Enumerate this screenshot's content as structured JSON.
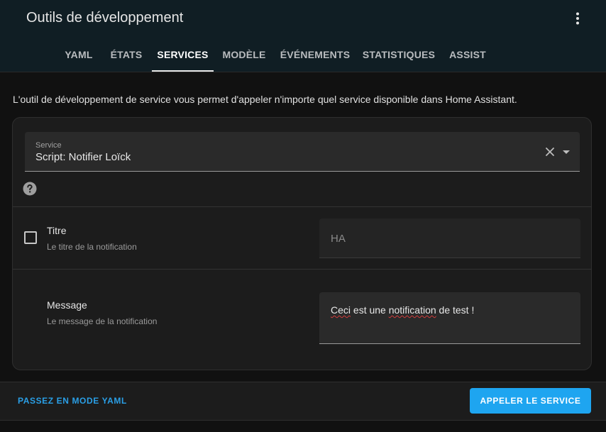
{
  "header": {
    "title": "Outils de développement",
    "menu_icon": "more-vert-icon"
  },
  "tabs": [
    {
      "label": "YAML",
      "active": false
    },
    {
      "label": "ÉTATS",
      "active": false
    },
    {
      "label": "SERVICES",
      "active": true
    },
    {
      "label": "MODÈLE",
      "active": false
    },
    {
      "label": "ÉVÉNEMENTS",
      "active": false
    },
    {
      "label": "STATISTIQUES",
      "active": false
    },
    {
      "label": "ASSIST",
      "active": false
    }
  ],
  "description": "L'outil de développement de service vous permet d'appeler n'importe quel service disponible dans Home Assistant.",
  "service": {
    "label": "Service",
    "value": "Script: Notifier Loïck",
    "clear_icon": "close-icon",
    "dropdown_icon": "caret-down-icon"
  },
  "help_icon": "help-circle-icon",
  "fields": {
    "titre": {
      "name": "Titre",
      "description": "Le titre de la notification",
      "placeholder": "HA",
      "checked": false
    },
    "message": {
      "name": "Message",
      "description": "Le message de la notification",
      "value_misspelled": "Ceci",
      "value_mid": " est une ",
      "value_misspelled2": "notification",
      "value_end": " de test !"
    }
  },
  "footer": {
    "yaml_mode_label": "PASSEZ EN MODE YAML",
    "call_service_label": "APPELER LE SERVICE"
  },
  "colors": {
    "accent": "#1ea5f0",
    "link": "#2a9fe6",
    "header_bg": "#101e24",
    "card_bg": "#1c1c1c"
  }
}
